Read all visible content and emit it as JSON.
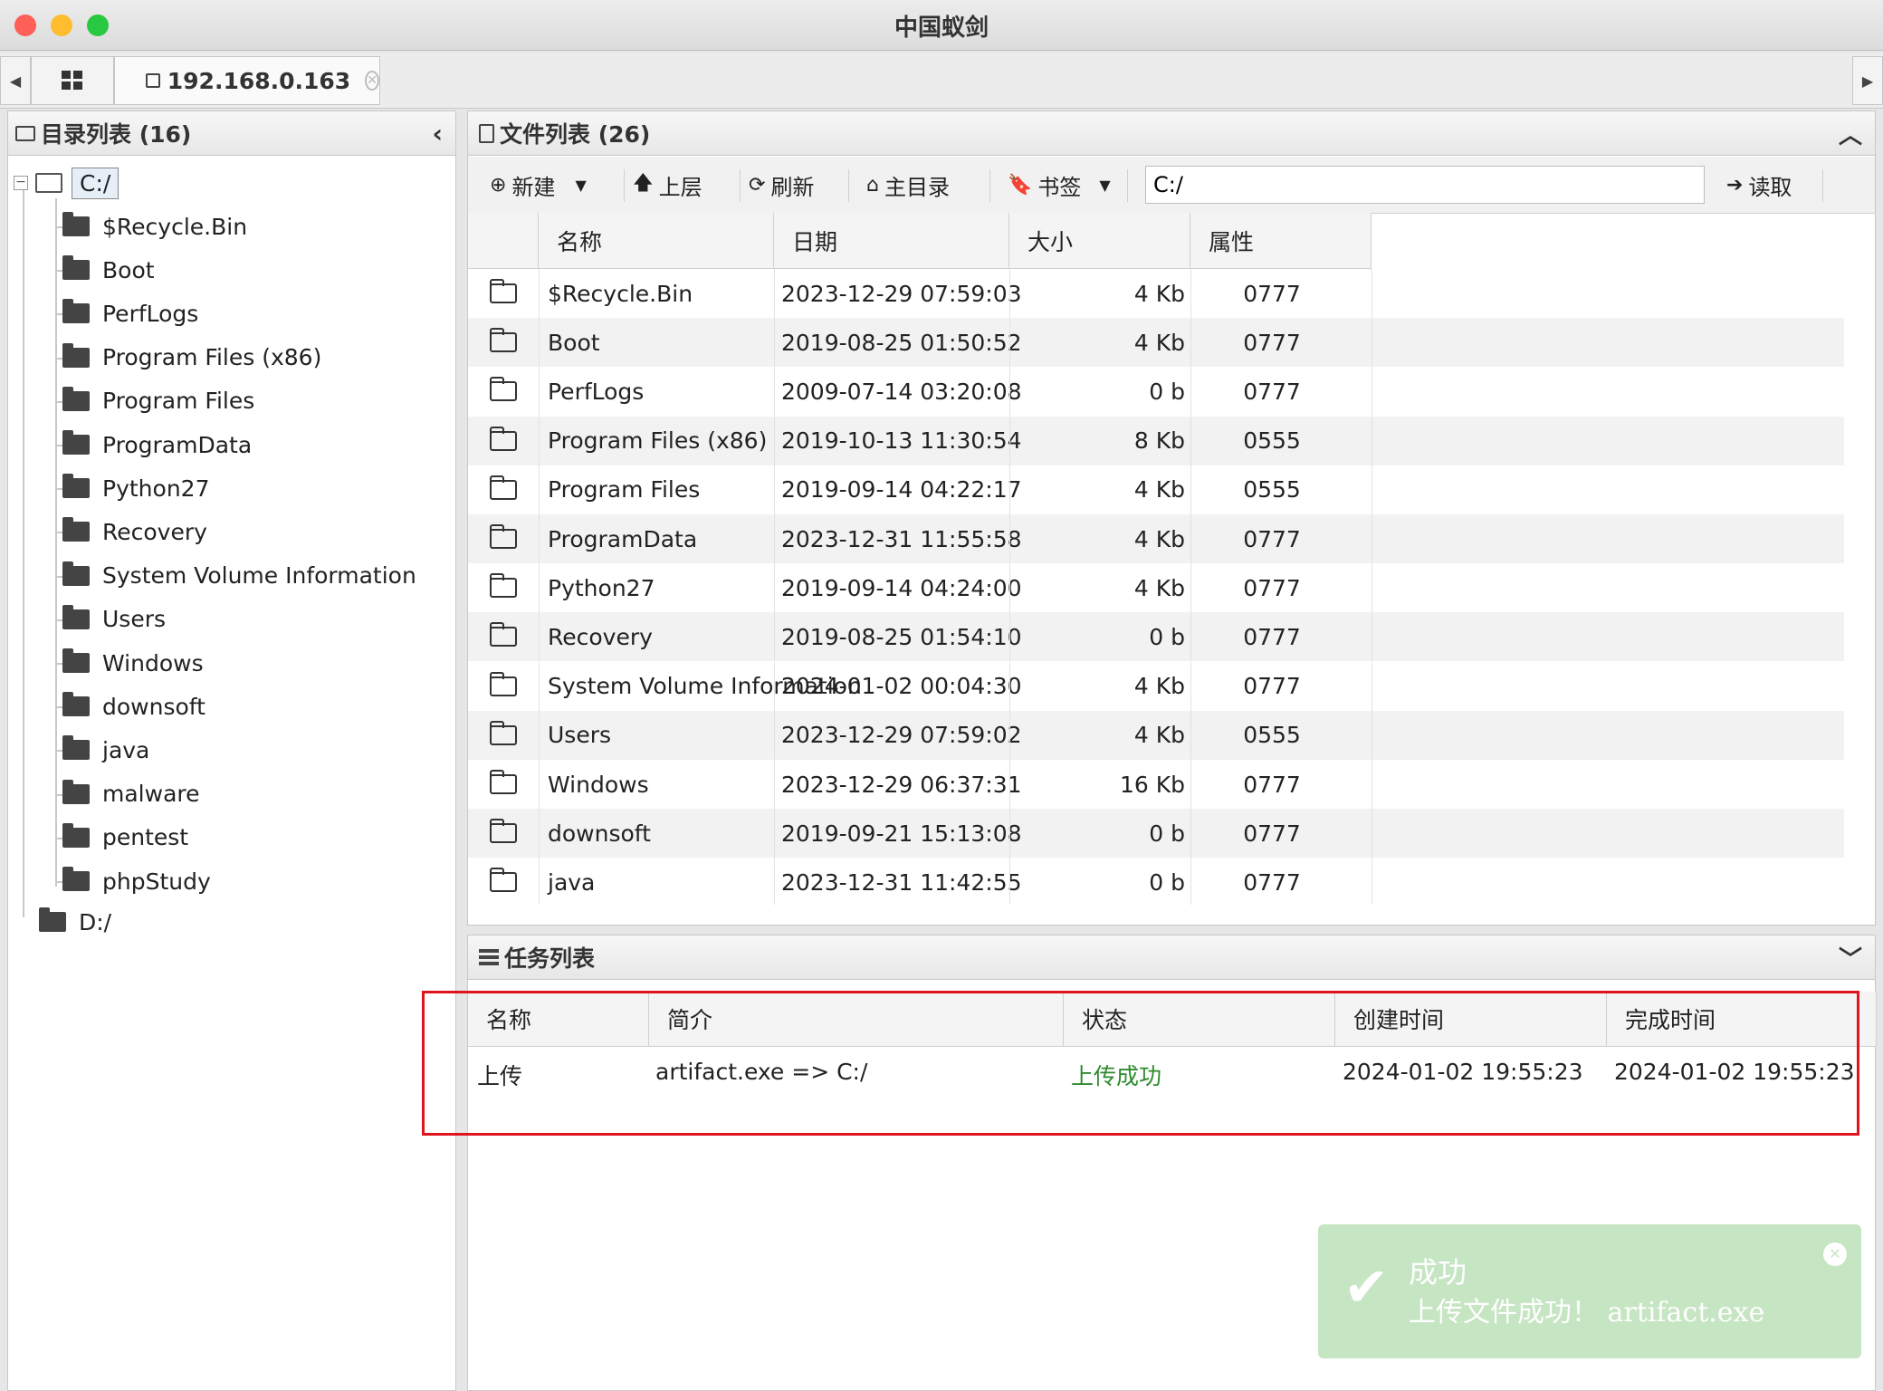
{
  "window": {
    "title": "中国蚁剑"
  },
  "tabs": [
    {
      "label": "192.168.0.163"
    }
  ],
  "left_panel": {
    "title": "目录列表 (16)",
    "root": "C:/",
    "items": [
      "$Recycle.Bin",
      "Boot",
      "PerfLogs",
      "Program Files (x86)",
      "Program Files",
      "ProgramData",
      "Python27",
      "Recovery",
      "System Volume Information",
      "Users",
      "Windows",
      "downsoft",
      "java",
      "malware",
      "pentest",
      "phpStudy"
    ],
    "second_root": "D:/"
  },
  "file_panel": {
    "title": "文件列表 (26)",
    "toolbar": {
      "new_label": "新建",
      "up_label": "上层",
      "refresh_label": "刷新",
      "home_label": "主目录",
      "bookmark_label": "书签",
      "path_value": "C:/",
      "read_label": "读取"
    },
    "columns": [
      "名称",
      "日期",
      "大小",
      "属性"
    ],
    "rows": [
      {
        "name": "$Recycle.Bin",
        "date": "2023-12-29 07:59:03",
        "size": "4 Kb",
        "attr": "0777"
      },
      {
        "name": "Boot",
        "date": "2019-08-25 01:50:52",
        "size": "4 Kb",
        "attr": "0777"
      },
      {
        "name": "PerfLogs",
        "date": "2009-07-14 03:20:08",
        "size": "0 b",
        "attr": "0777"
      },
      {
        "name": "Program Files (x86)",
        "date": "2019-10-13 11:30:54",
        "size": "8 Kb",
        "attr": "0555"
      },
      {
        "name": "Program Files",
        "date": "2019-09-14 04:22:17",
        "size": "4 Kb",
        "attr": "0555"
      },
      {
        "name": "ProgramData",
        "date": "2023-12-31 11:55:58",
        "size": "4 Kb",
        "attr": "0777"
      },
      {
        "name": "Python27",
        "date": "2019-09-14 04:24:00",
        "size": "4 Kb",
        "attr": "0777"
      },
      {
        "name": "Recovery",
        "date": "2019-08-25 01:54:10",
        "size": "0 b",
        "attr": "0777"
      },
      {
        "name": "System Volume Information",
        "date": "2024-01-02 00:04:30",
        "size": "4 Kb",
        "attr": "0777"
      },
      {
        "name": "Users",
        "date": "2023-12-29 07:59:02",
        "size": "4 Kb",
        "attr": "0555"
      },
      {
        "name": "Windows",
        "date": "2023-12-29 06:37:31",
        "size": "16 Kb",
        "attr": "0777"
      },
      {
        "name": "downsoft",
        "date": "2019-09-21 15:13:08",
        "size": "0 b",
        "attr": "0777"
      },
      {
        "name": "java",
        "date": "2023-12-31 11:42:55",
        "size": "0 b",
        "attr": "0777"
      }
    ]
  },
  "task_panel": {
    "title": "任务列表",
    "columns": [
      "名称",
      "简介",
      "状态",
      "创建时间",
      "完成时间"
    ],
    "rows": [
      {
        "name": "上传",
        "desc": "artifact.exe => C:/",
        "status": "上传成功",
        "created": "2024-01-02 19:55:23",
        "finished": "2024-01-02 19:55:23"
      }
    ]
  },
  "toast": {
    "title": "成功",
    "message": "上传文件成功！ artifact.exe"
  },
  "colors": {
    "success_text": "#2e8b2e",
    "highlight_box": "#e0141e",
    "toast_bg": "#c6e5c3"
  }
}
